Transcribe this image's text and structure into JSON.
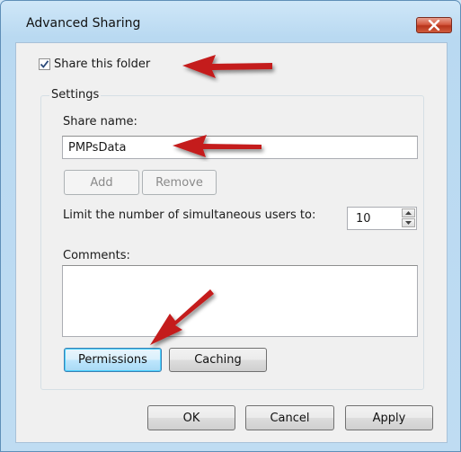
{
  "window": {
    "title": "Advanced Sharing",
    "close_icon": "close-icon"
  },
  "share": {
    "checkbox_label": "Share this folder",
    "checked": true
  },
  "settings": {
    "group_label": "Settings",
    "share_name_label": "Share name:",
    "share_name_value": "PMPsData",
    "add_label": "Add",
    "remove_label": "Remove",
    "limit_label": "Limit the number of simultaneous users to:",
    "limit_value": "10",
    "comments_label": "Comments:",
    "comments_value": "",
    "permissions_label": "Permissions",
    "caching_label": "Caching"
  },
  "footer": {
    "ok_label": "OK",
    "cancel_label": "Cancel",
    "apply_label": "Apply"
  },
  "colors": {
    "annotation_arrow": "#c41a1a",
    "focus_button": "#a7d9f5",
    "close_button": "#cf5b3c"
  }
}
